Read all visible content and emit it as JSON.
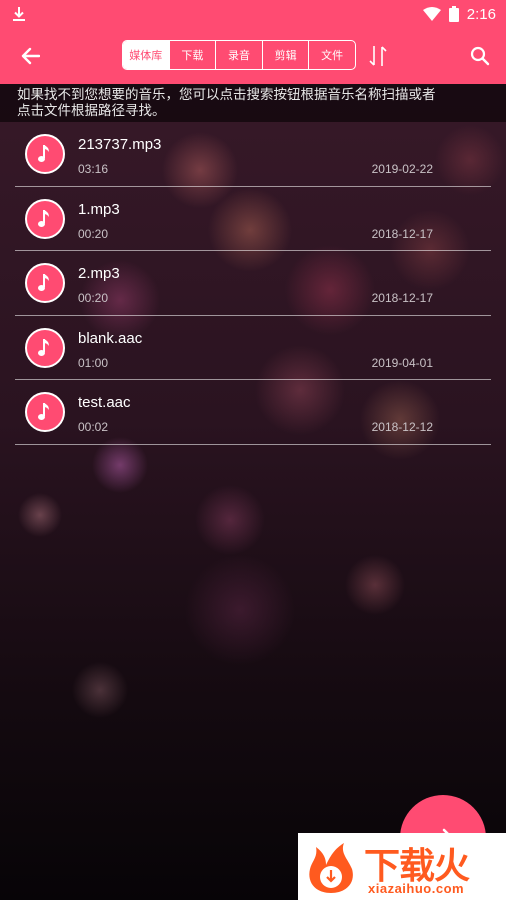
{
  "status_bar": {
    "time": "2:16",
    "icons": [
      "download-icon",
      "wifi-icon",
      "battery-icon"
    ]
  },
  "toolbar": {
    "tabs": [
      {
        "label": "媒体库",
        "selected": true
      },
      {
        "label": "下载",
        "selected": false
      },
      {
        "label": "录音",
        "selected": false
      },
      {
        "label": "剪辑",
        "selected": false
      },
      {
        "label": "文件",
        "selected": false
      }
    ],
    "icons": [
      "back-arrow-icon",
      "sort-icon",
      "search-icon"
    ]
  },
  "hint": {
    "line1": "如果找不到您想要的音乐，您可以点击搜索按钮根据音乐名称扫描或者",
    "line2": "点击文件根据路径寻找。"
  },
  "files": [
    {
      "name": "213737.mp3",
      "duration": "03:16",
      "date": "2019-02-22"
    },
    {
      "name": "1.mp3",
      "duration": "00:20",
      "date": "2018-12-17"
    },
    {
      "name": "2.mp3",
      "duration": "00:20",
      "date": "2018-12-17"
    },
    {
      "name": "blank.aac",
      "duration": "01:00",
      "date": "2019-04-01"
    },
    {
      "name": "test.aac",
      "duration": "00:02",
      "date": "2018-12-12"
    }
  ],
  "fab": {
    "icon": "arrow-right-icon"
  },
  "watermark": {
    "brand": "下载火",
    "url": "xiazaihuo.com"
  },
  "colors": {
    "accent": "#ff4b72",
    "watermark": "#ff5a1f"
  }
}
